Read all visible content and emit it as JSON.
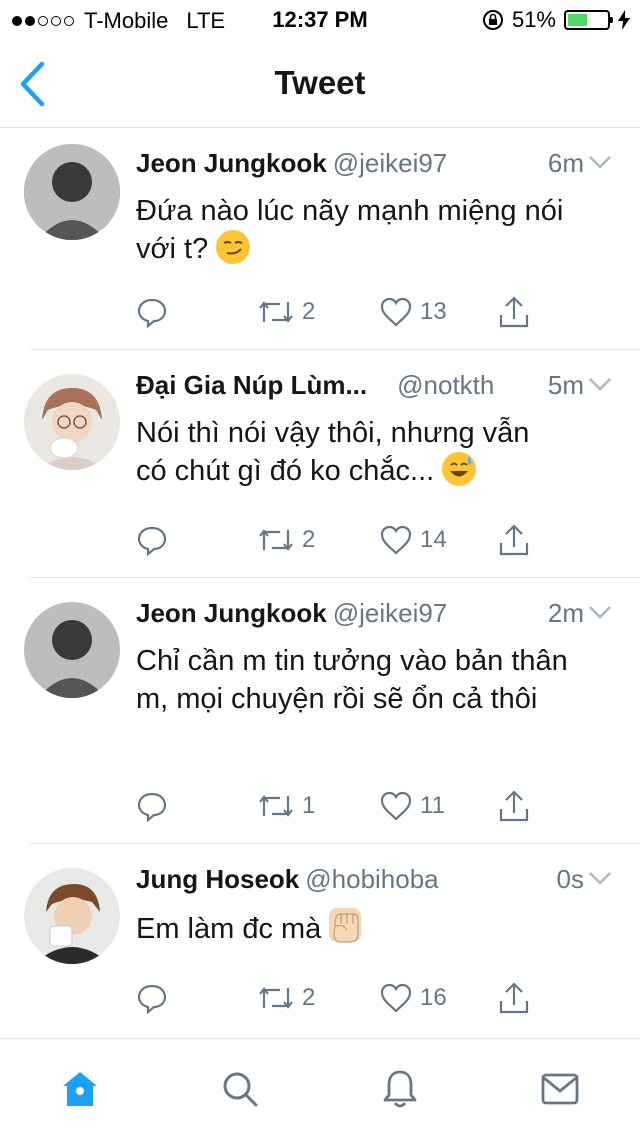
{
  "status_bar": {
    "carrier": "T-Mobile",
    "network": "LTE",
    "time": "12:37 PM",
    "battery_percent": "51%",
    "battery_level": 0.51,
    "signal_bars_filled": 2,
    "signal_bars_total": 5
  },
  "nav": {
    "title": "Tweet",
    "accent_color": "#1da1f2"
  },
  "tweets": [
    {
      "name": "Jeon Jungkook",
      "handle": "@jeikei97",
      "time": "6m",
      "text": "Đứa nào lúc nãy mạnh miệng nói với t?",
      "emoji": "smirk-emoji",
      "retweets": "2",
      "likes": "13"
    },
    {
      "name": "Đại Gia Núp Lùm...",
      "handle": "@notkth",
      "time": "5m",
      "text": "Nói thì nói vậy thôi, nhưng vẫn có chút gì đó ko chắc...",
      "emoji": "sweat-smile-emoji",
      "retweets": "2",
      "likes": "14"
    },
    {
      "name": "Jeon Jungkook",
      "handle": "@jeikei97",
      "time": "2m",
      "text": "Chỉ cần m tin tưởng vào bản thân m, mọi chuyện rồi sẽ ổn cả thôi",
      "emoji": "",
      "retweets": "1",
      "likes": "11"
    },
    {
      "name": "Jung Hoseok",
      "handle": "@hobihoba",
      "time": "0s",
      "text": "Em làm đc mà",
      "emoji": "raised-fist-emoji",
      "retweets": "2",
      "likes": "16"
    }
  ],
  "tab_bar": {
    "items": [
      "home-icon",
      "search-icon",
      "notifications-icon",
      "messages-icon"
    ],
    "active_color": "#1da1f2",
    "inactive_color": "#657786"
  }
}
